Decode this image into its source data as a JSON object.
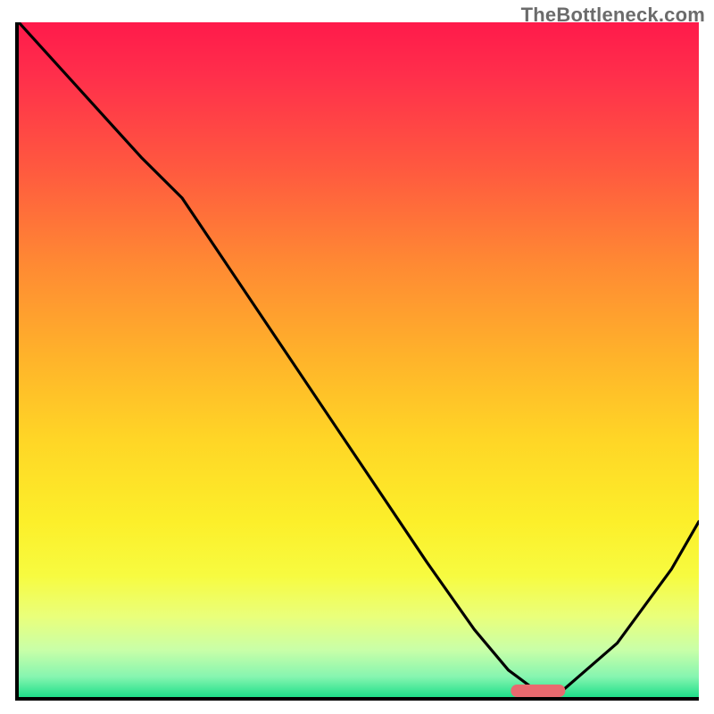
{
  "watermark": "TheBottleneck.com",
  "chart_data": {
    "type": "line",
    "title": "",
    "xlabel": "",
    "ylabel": "",
    "xlim": [
      0,
      100
    ],
    "ylim": [
      0,
      100
    ],
    "x": [
      0,
      9,
      18,
      24,
      30,
      40,
      50,
      60,
      67,
      72,
      76,
      80,
      88,
      96,
      100
    ],
    "values": [
      100,
      90,
      80,
      74,
      65,
      50,
      35,
      20,
      10,
      4,
      1,
      1,
      8,
      19,
      26
    ],
    "marker_range_x": [
      72,
      80
    ],
    "gradient_stops": [
      {
        "pos": 0,
        "color": "#ff1a4b"
      },
      {
        "pos": 50,
        "color": "#ffb42a"
      },
      {
        "pos": 82,
        "color": "#f7fb40"
      },
      {
        "pos": 100,
        "color": "#1fdf8a"
      }
    ]
  }
}
